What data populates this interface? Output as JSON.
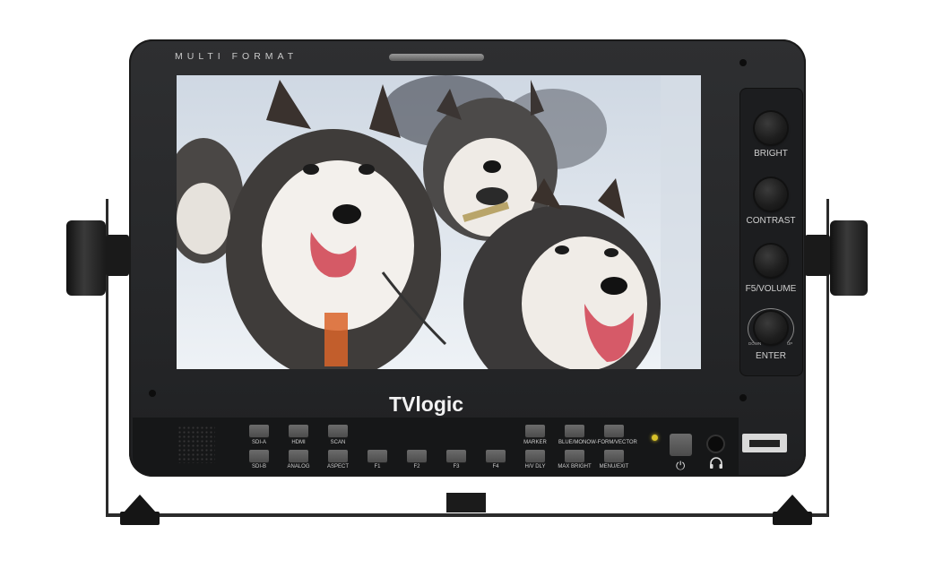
{
  "device": {
    "brand_top": "MULTI FORMAT",
    "logo": "TVlogic"
  },
  "side_panel": {
    "knobs": [
      {
        "label": "BRIGHT",
        "icon": "bright-knob-icon"
      },
      {
        "label": "CONTRAST",
        "icon": "contrast-knob-icon"
      },
      {
        "label": "F5/VOLUME",
        "icon": "volume-knob-icon"
      },
      {
        "label": "ENTER",
        "icon": "enter-knob-icon",
        "down_label": "DOWN",
        "up_label": "UP"
      }
    ]
  },
  "buttons": {
    "top_row": [
      "SDI-A",
      "HDMI",
      "SCAN",
      "MARKER",
      "BLUE/MONO",
      "W-FORM/VECTOR"
    ],
    "bottom_row": [
      "SDI-B",
      "ANALOG",
      "ASPECT",
      "F1",
      "F2",
      "F3",
      "F4",
      "H/V DLY",
      "MAX BRIGHT",
      "MENU/EXIT"
    ]
  },
  "icons": {
    "power": "power-icon",
    "headphone": "headphone-icon",
    "usb": "usb-port-icon"
  },
  "colors": {
    "bezel": "#2a2b2d",
    "led": "#d7c12a",
    "text": "#cfcfcf"
  }
}
